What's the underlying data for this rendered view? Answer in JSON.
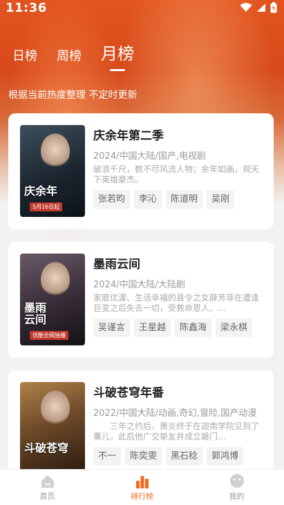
{
  "status": {
    "time": "11:36"
  },
  "tabs": [
    {
      "label": "日榜"
    },
    {
      "label": "周榜"
    },
    {
      "label": "月榜"
    }
  ],
  "subtitle": "根据当前热度整理 不定时更新",
  "items": [
    {
      "title": "庆余年第二季",
      "meta": "2024/中国大陆/国产,电视剧",
      "desc": "破浪千尺，数不尽风流人物；余年如画，观天下英雄豪杰。",
      "cast": [
        "张若昀",
        "李沁",
        "陈道明",
        "吴刚"
      ],
      "poster_title": "庆余年",
      "poster_date": "5月16日起"
    },
    {
      "title": "墨雨云间",
      "meta": "2024/中国大陆/大陆剧",
      "desc": "家庭优渥、生活幸福的县令之女薛芳菲在遭逢巨变之后失去一切，受救命恩人、…",
      "cast": [
        "吴谨言",
        "王星越",
        "陈鑫海",
        "梁永棋"
      ],
      "poster_title": "墨雨\n云间",
      "poster_date": "优酷全网独播"
    },
    {
      "title": "斗破苍穹年番",
      "meta": "2022/中国大陆/动画,奇幻,冒险,国产动漫",
      "desc": "　　三年之约后，萧炎终于在迦南学院见到了薰儿，此后他广交挚友并成立磐门…",
      "cast": [
        "不一",
        "陈奕雯",
        "黑石稔",
        "郭鸿博"
      ],
      "poster_title": "斗破苍穹",
      "poster_date": ""
    }
  ],
  "nav": [
    {
      "label": "首页"
    },
    {
      "label": "排行榜"
    },
    {
      "label": "我的"
    }
  ],
  "colors": {
    "accent": "#f26a1b",
    "header": "#e2541f"
  }
}
